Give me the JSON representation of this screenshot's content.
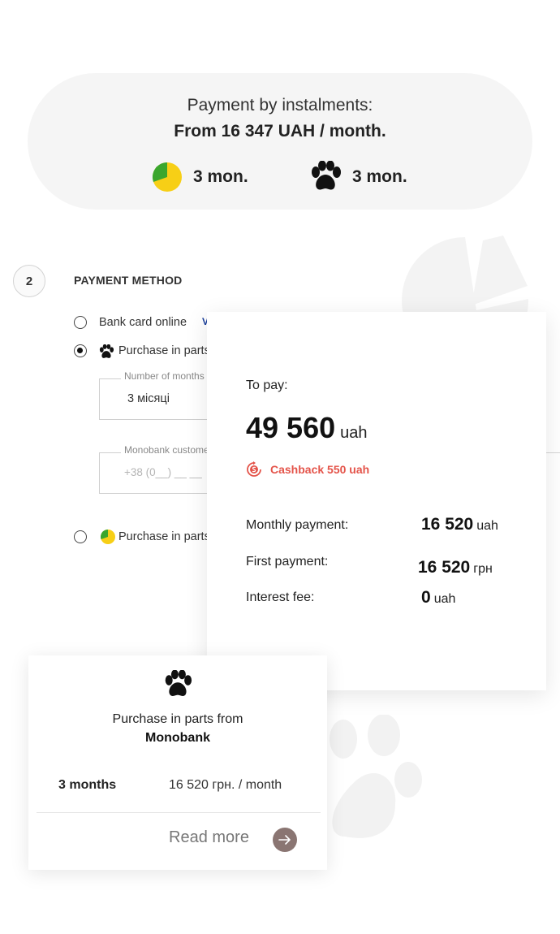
{
  "instalments": {
    "line1": "Payment by instalments:",
    "line2": "From 16 347 UAH / month.",
    "option1": {
      "icon": "privatbank-pie-icon",
      "label": "3 mon."
    },
    "option2": {
      "icon": "paw-icon",
      "label": "3 mon."
    }
  },
  "step": {
    "number": "2",
    "title": "PAYMENT METHOD"
  },
  "payment_options": {
    "bank_card": "Bank card online",
    "parts_mono": "Purchase in parts from Monobank",
    "parts_privat": "Purchase in parts from PrivatBank",
    "selected": "parts_mono"
  },
  "form": {
    "months_label": "Number of months",
    "months_value": "3 місяці",
    "customer_label": "Monobank customer phone",
    "phone_placeholder": "+38 (0__) __ __"
  },
  "summary": {
    "to_pay_label": "To pay:",
    "amount": "49 560",
    "amount_currency": "uah",
    "cashback": "Cashback 550 uah",
    "monthly_label": "Monthly payment:",
    "monthly_value": "16 520",
    "monthly_currency": "uah",
    "first_label": "First payment:",
    "first_value": "16 520",
    "first_currency": "грн",
    "interest_label": "Interest fee:",
    "interest_value": "0",
    "interest_currency": "uah"
  },
  "popup": {
    "title_line1": "Purchase in parts from",
    "title_line2": "Monobank",
    "term": "3 months",
    "price": "16 520 грн. / month",
    "read_more": "Read more"
  },
  "colors": {
    "pill_bg": "#f5f5f5",
    "cashback": "#e4544a",
    "arrow_bg": "#8a7572",
    "privat_green": "#3aa62d",
    "privat_yellow": "#f7cf16"
  }
}
